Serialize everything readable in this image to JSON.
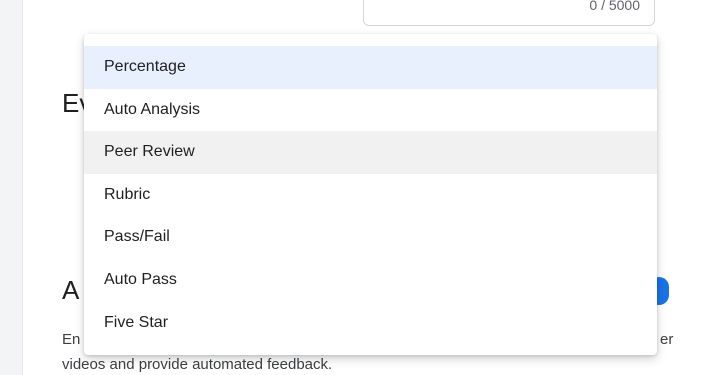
{
  "char_counter": "0 / 5000",
  "sections": {
    "evaluation_heading_partial": "Ev",
    "auto_heading_partial": "A",
    "description_left": "En",
    "description_right_partial": "er",
    "description_line2": "videos and provide automated feedback."
  },
  "dropdown": {
    "selected_index": 0,
    "hovered_index": 2,
    "options": [
      "Percentage",
      "Auto Analysis",
      "Peer Review",
      "Rubric",
      "Pass/Fail",
      "Auto Pass",
      "Five Star"
    ]
  },
  "colors": {
    "selected_bg": "#e8f0fe",
    "hover_bg": "#f1f1f1",
    "accent": "#1a73e8"
  }
}
